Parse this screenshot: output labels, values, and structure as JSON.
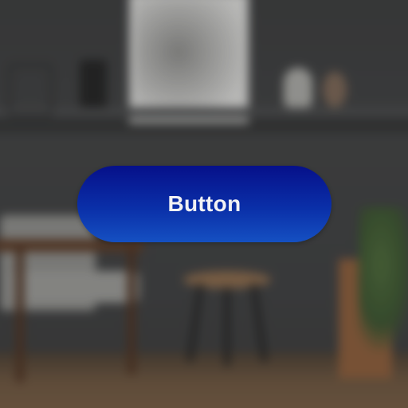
{
  "button": {
    "label": "Button"
  },
  "colors": {
    "button_gradient_top": "#06108a",
    "button_gradient_bottom": "#1550c2",
    "button_text": "#f2f2f4",
    "background_wall": "#3d3e3f"
  },
  "background": {
    "description_icons": [
      "picture-frame",
      "lamp",
      "vase",
      "armchair",
      "stool",
      "side-table",
      "plant"
    ]
  }
}
